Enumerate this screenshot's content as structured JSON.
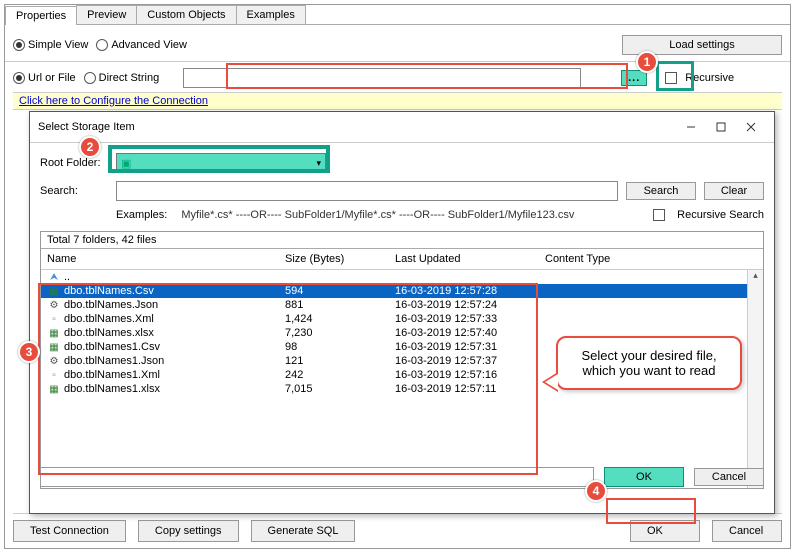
{
  "tabs": [
    "Properties",
    "Preview",
    "Custom Objects",
    "Examples"
  ],
  "activeTab": 0,
  "viewRadios": {
    "simple": "Simple View",
    "advanced": "Advanced View"
  },
  "loadSettings": "Load settings",
  "srcRadios": {
    "url": "Url or File",
    "direct": "Direct String"
  },
  "recursive": "Recursive",
  "configureLink": "Click here to Configure the Connection",
  "bottomButtons": {
    "test": "Test Connection",
    "copy": "Copy settings",
    "gen": "Generate SQL",
    "ok": "OK",
    "cancel": "Cancel"
  },
  "dialog": {
    "title": "Select Storage Item",
    "rootFolderLabel": "Root Folder:",
    "rootFolderValue": "",
    "searchLabel": "Search:",
    "searchBtn": "Search",
    "clearBtn": "Clear",
    "examplesLabel": "Examples:",
    "examplesText": "Myfile*.cs*   ----OR----   SubFolder1/Myfile*.cs*   ----OR----   SubFolder1/Myfile123.csv",
    "recursiveSearch": "Recursive Search",
    "totalLabel": "Total 7 folders, 42 files",
    "columns": {
      "name": "Name",
      "size": "Size (Bytes)",
      "date": "Last Updated",
      "ct": "Content Type"
    },
    "rows": [
      {
        "icon": "up",
        "name": "..",
        "size": "",
        "date": ""
      },
      {
        "icon": "csv",
        "name": "dbo.tblNames.Csv",
        "size": "594",
        "date": "16-03-2019 12:57:28",
        "sel": true
      },
      {
        "icon": "json",
        "name": "dbo.tblNames.Json",
        "size": "881",
        "date": "16-03-2019 12:57:24"
      },
      {
        "icon": "xml",
        "name": "dbo.tblNames.Xml",
        "size": "1,424",
        "date": "16-03-2019 12:57:33"
      },
      {
        "icon": "xlsx",
        "name": "dbo.tblNames.xlsx",
        "size": "7,230",
        "date": "16-03-2019 12:57:40"
      },
      {
        "icon": "csv",
        "name": "dbo.tblNames1.Csv",
        "size": "98",
        "date": "16-03-2019 12:57:31"
      },
      {
        "icon": "json",
        "name": "dbo.tblNames1.Json",
        "size": "121",
        "date": "16-03-2019 12:57:37"
      },
      {
        "icon": "xml",
        "name": "dbo.tblNames1.Xml",
        "size": "242",
        "date": "16-03-2019 12:57:16"
      },
      {
        "icon": "xlsx",
        "name": "dbo.tblNames1.xlsx",
        "size": "7,015",
        "date": "16-03-2019 12:57:11"
      }
    ],
    "ok": "OK",
    "cancel": "Cancel"
  },
  "callout": "Select your desired file, which you want to read",
  "badges": [
    "1",
    "2",
    "3",
    "4"
  ]
}
